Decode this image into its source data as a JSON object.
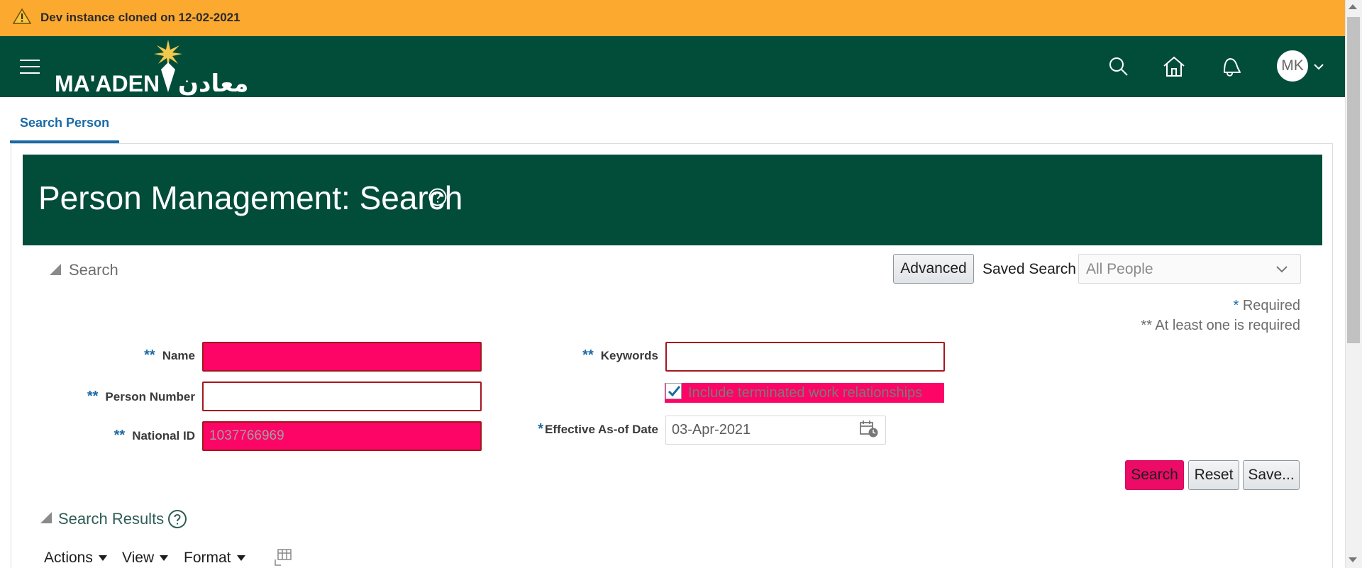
{
  "banner": {
    "text": "Dev instance cloned on 12-02-2021",
    "icon": "warning-icon"
  },
  "header": {
    "logo_latin": "MA'ADEN",
    "logo_arabic": "معادن",
    "avatar_initials": "MK",
    "icons": [
      "menu-icon",
      "search-icon",
      "home-icon",
      "notification-bell-icon",
      "chevron-down-icon"
    ]
  },
  "tabs": [
    {
      "label": "Search Person"
    }
  ],
  "page": {
    "title": "Person Management: Search"
  },
  "search": {
    "section_label": "Search",
    "advanced_label": "Advanced",
    "saved_search_label": "Saved Search",
    "saved_search_value": "All People",
    "required_note": "Required",
    "atleast_note": "** At least one is required",
    "star": "*",
    "double_star": "**",
    "fields": {
      "name_label": "Name",
      "name_value": "",
      "person_number_label": "Person Number",
      "person_number_value": "",
      "national_id_label": "National ID",
      "national_id_value": "1037766969",
      "keywords_label": "Keywords",
      "keywords_value": "",
      "include_terminated_label": "Include terminated work relationships",
      "include_terminated_checked": true,
      "effective_date_label": "Effective As-of Date",
      "effective_date_value": "03-Apr-2021"
    },
    "buttons": {
      "search": "Search",
      "reset": "Reset",
      "save": "Save..."
    }
  },
  "results": {
    "section_label": "Search Results",
    "menu": {
      "actions": "Actions",
      "view": "View",
      "format": "Format"
    }
  },
  "colors": {
    "banner": "#fca930",
    "header": "#024d3a",
    "title_band": "#024d3a",
    "highlight": "#fd0467",
    "tab_accent": "#1a6aa8",
    "error_border": "#a4171e"
  }
}
